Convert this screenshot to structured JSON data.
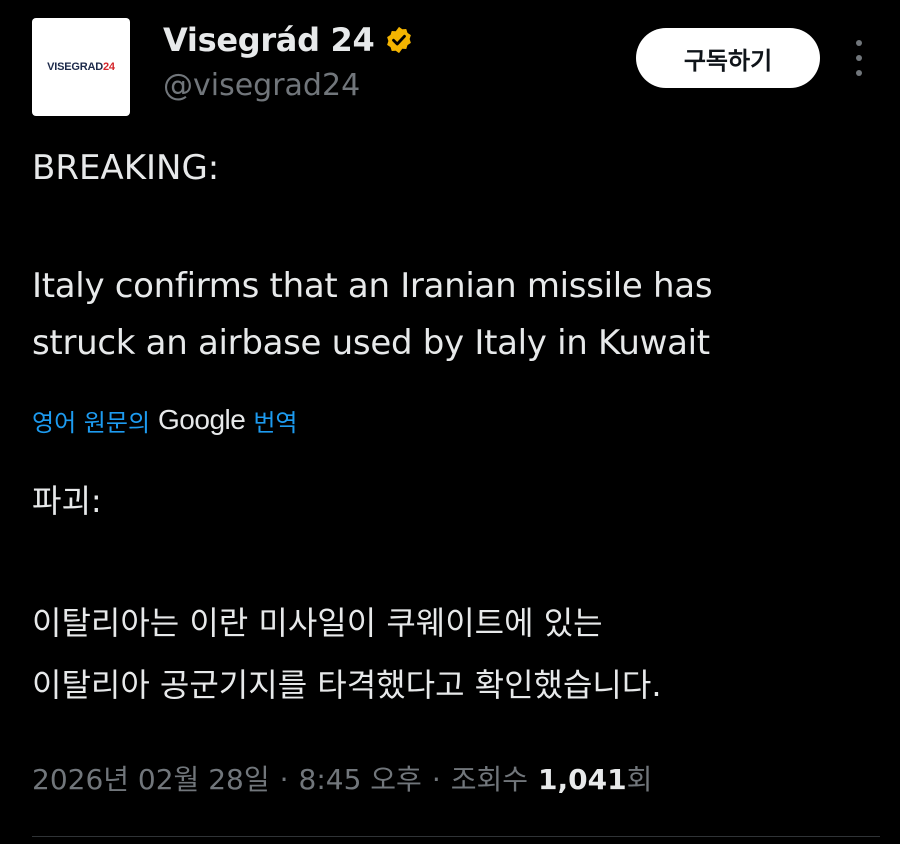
{
  "author": {
    "avatar_text_main": "VISEGRAD",
    "avatar_text_accent": "24",
    "display_name": "Visegrád 24",
    "handle": "@visegrad24",
    "verified_icon": "gold-verified-badge-icon"
  },
  "header": {
    "subscribe_label": "구독하기",
    "more_icon": "more-vertical-icon"
  },
  "post": {
    "line1": "BREAKING:",
    "line2": "Italy confirms that an Iranian missile has",
    "line3": "struck an airbase used by Italy in Kuwait"
  },
  "translation_bar": {
    "prefix": "영어 원문의",
    "brand": "Google",
    "suffix": "번역"
  },
  "translated": {
    "line1": "파괴:",
    "line2": "이탈리아는 이란 미사일이 쿠웨이트에 있는",
    "line3": "이탈리아 공군기지를 타격했다고 확인했습니다."
  },
  "meta": {
    "date": "2026년 02월 28일",
    "sep1": "·",
    "time": "8:45 오후",
    "sep2": "·",
    "views_label": "조회수",
    "views_count": "1,041",
    "views_suffix": "회"
  },
  "colors": {
    "background": "#000000",
    "text": "#e7e9ea",
    "muted": "#71767b",
    "link": "#1d9bf0",
    "verified": "#f4b400"
  }
}
